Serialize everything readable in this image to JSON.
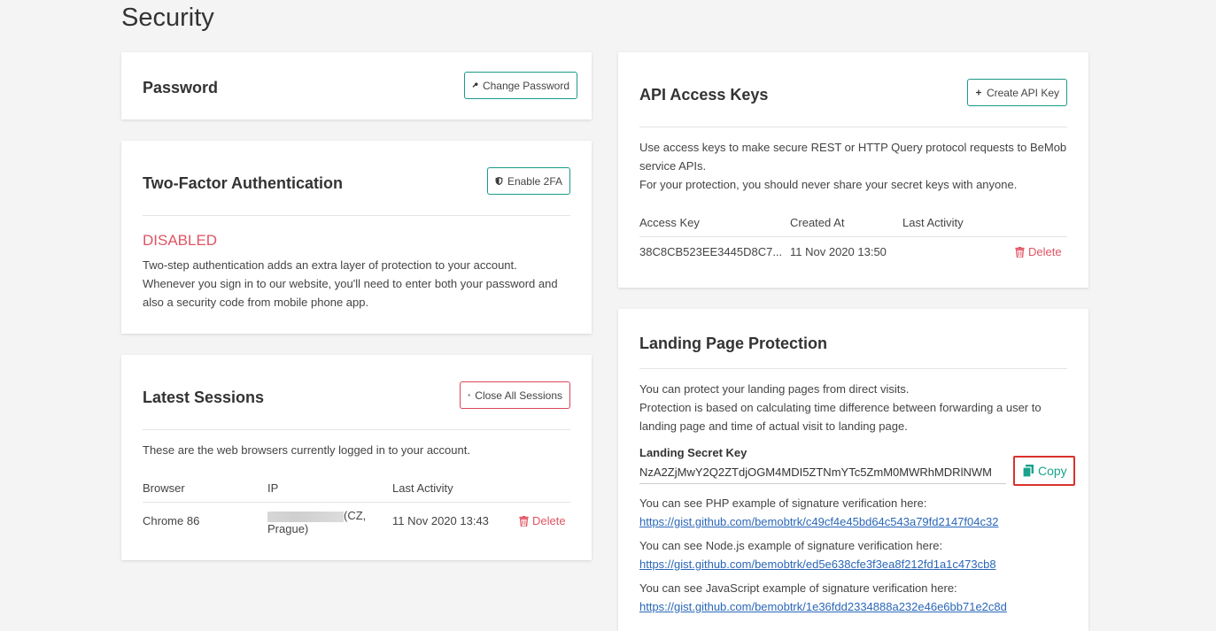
{
  "page": {
    "title": "Security"
  },
  "password": {
    "title": "Password",
    "button": "Change Password"
  },
  "twofa": {
    "title": "Two-Factor Authentication",
    "button": "Enable 2FA",
    "status": "DISABLED",
    "desc_line1": "Two-step authentication adds an extra layer of protection to your account.",
    "desc_line2": "Whenever you sign in to our website, you'll need to enter both your password and",
    "desc_line3": "also a security code from mobile phone app."
  },
  "sessions": {
    "title": "Latest Sessions",
    "button": "Close All Sessions",
    "desc": "These are the web browsers currently logged in to your account.",
    "columns": [
      "Browser",
      "IP",
      "Last Activity"
    ],
    "rows": [
      {
        "browser": "Chrome 86",
        "ip_suffix": "(CZ,",
        "ip_city": "Prague)",
        "last_activity": "11 Nov 2020 13:43",
        "action": "Delete"
      }
    ]
  },
  "api": {
    "title": "API Access Keys",
    "button": "Create API Key",
    "desc_line1": "Use access keys to make secure REST or HTTP Query protocol requests to BeMob",
    "desc_line2": "service APIs.",
    "desc_line3": "For your protection, you should never share your secret keys with anyone.",
    "columns": [
      "Access Key",
      "Created At",
      "Last Activity"
    ],
    "rows": [
      {
        "key": "38C8CB523EE3445D8C7...",
        "created": "11 Nov 2020 13:50",
        "last_activity": "",
        "action": "Delete"
      }
    ]
  },
  "landing": {
    "title": "Landing Page Protection",
    "desc_line1": "You can protect your landing pages from direct visits.",
    "desc_line2": "Protection is based on calculating time difference between forwarding a user to",
    "desc_line3": "landing page and time of actual visit to landing page.",
    "key_label": "Landing Secret Key",
    "key_value": "NzA2ZjMwY2Q2ZTdjOGM4MDI5ZTNmYTc5ZmM0MWRhMDRlNWM",
    "copy_label": "Copy",
    "php_text": "You can see PHP example of signature verification here:",
    "php_link": "https://gist.github.com/bemobtrk/c49cf4e45bd64c543a79fd2147f04c32",
    "node_text": "You can see Node.js example of signature verification here:",
    "node_link": "https://gist.github.com/bemobtrk/ed5e638cfe3f3ea8f212fd1a1c473cb8",
    "js_text": "You can see JavaScript example of signature verification here:",
    "js_link": "https://gist.github.com/bemobtrk/1e36fdd2334888a232e46e6bb71e2c8d"
  },
  "colors": {
    "accent": "#1a9b86",
    "danger": "#e05464",
    "link": "#2a67b8",
    "highlight": "#d9322b"
  },
  "icons": [
    "key-icon",
    "shield-icon",
    "close-icon",
    "plus-icon",
    "trash-icon",
    "copy-icon"
  ]
}
